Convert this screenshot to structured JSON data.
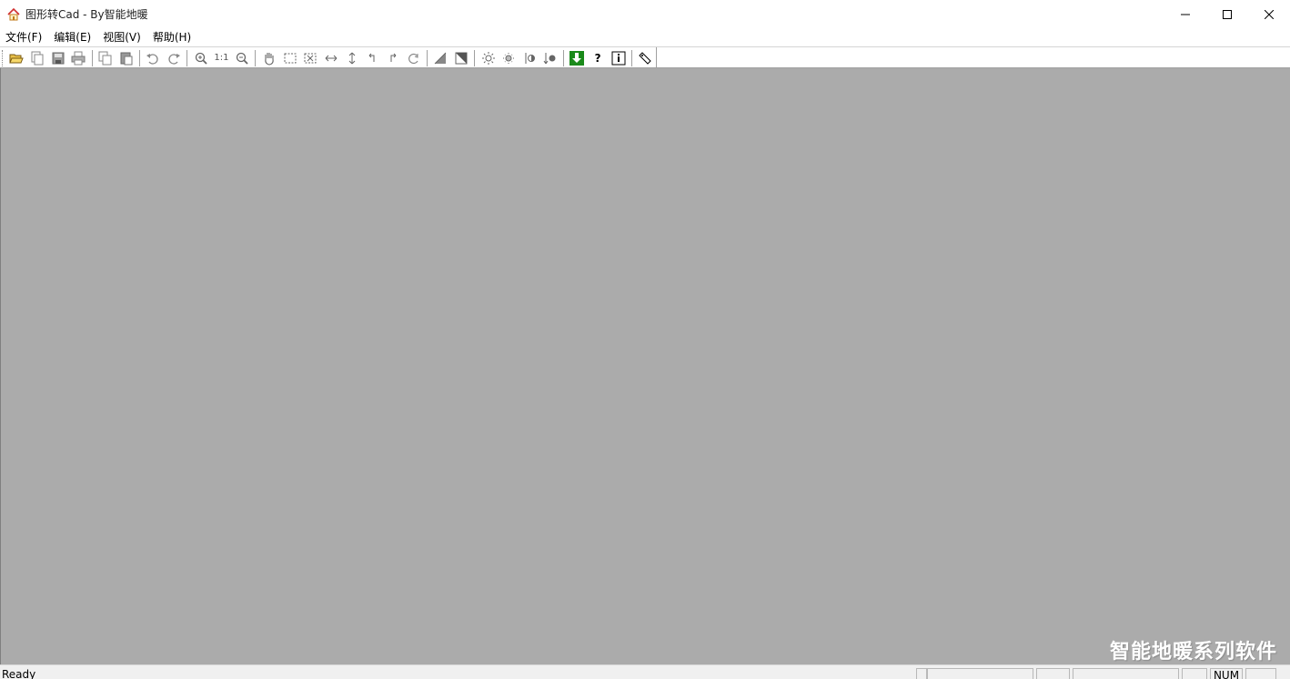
{
  "window": {
    "title": "图形转Cad - By智能地暖",
    "icon": "home-icon",
    "controls": [
      "minimize-icon",
      "maximize-icon",
      "close-icon"
    ]
  },
  "menu": [
    "文件(F)",
    "编辑(E)",
    "视图(V)",
    "帮助(H)"
  ],
  "toolbar": {
    "buttons": [
      "open-folder-icon",
      "new-document-icon",
      "save-icon",
      "print-icon",
      "copy-icon",
      "paste-icon",
      "undo-icon",
      "redo-icon",
      "zoom-in-icon",
      "zoom-actual-icon",
      "zoom-out-icon",
      "pan-hand-icon",
      "select-rect-icon",
      "delete-selection-icon",
      "flip-horizontal-icon",
      "flip-vertical-icon",
      "rotate-left-icon",
      "rotate-right-icon",
      "refresh-icon",
      "contrast-icon",
      "invert-icon",
      "brightness-up-icon",
      "brightness-down-icon",
      "threshold-left-icon",
      "threshold-right-icon",
      "export-download-icon",
      "help-question-icon",
      "info-icon",
      "tag-icon"
    ],
    "zoom_actual_label": "1:1",
    "help_label": "?"
  },
  "canvas": {
    "background": "#ababab",
    "watermark": "智能地暖系列软件"
  },
  "status": {
    "text": "Ready",
    "num_indicator": "NUM"
  },
  "colors": {
    "accent_green": "#1a8a1a",
    "icon_red": "#d03030"
  }
}
